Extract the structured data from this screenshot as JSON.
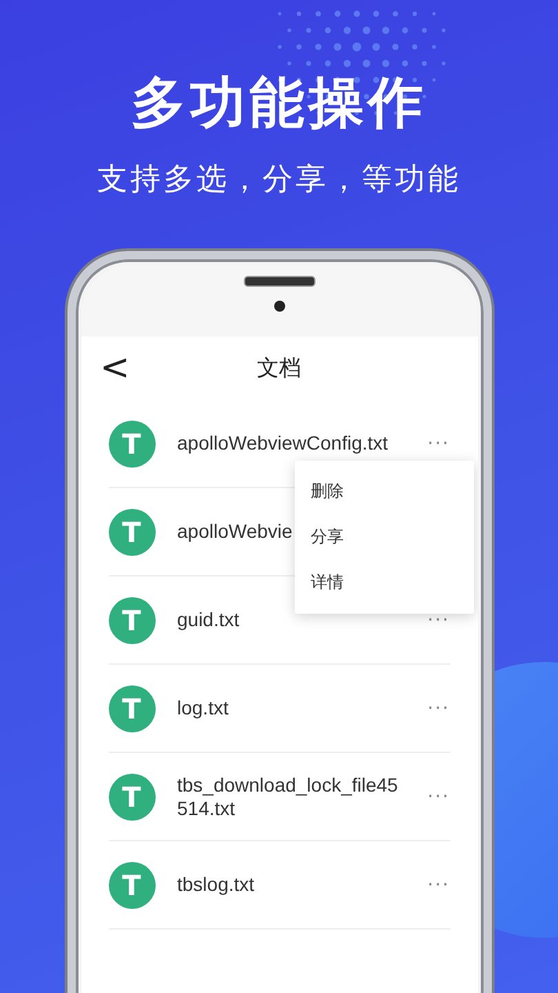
{
  "headline": "多功能操作",
  "subtitle": "支持多选，分享，等功能",
  "screen": {
    "back": "<",
    "title": "文档",
    "files": [
      {
        "icon_letter": "T",
        "name": "apolloWebviewConfig.txt",
        "more": "···",
        "menu": [
          "删除",
          "分享",
          "详情"
        ]
      },
      {
        "icon_letter": "T",
        "name": "apolloWebvie"
      },
      {
        "icon_letter": "T",
        "name": "guid.txt",
        "more": "···"
      },
      {
        "icon_letter": "T",
        "name": "log.txt",
        "more": "···"
      },
      {
        "icon_letter": "T",
        "name": "tbs_download_lock_file45514.txt",
        "more": "···"
      },
      {
        "icon_letter": "T",
        "name": "tbslog.txt",
        "more": "···"
      }
    ]
  }
}
